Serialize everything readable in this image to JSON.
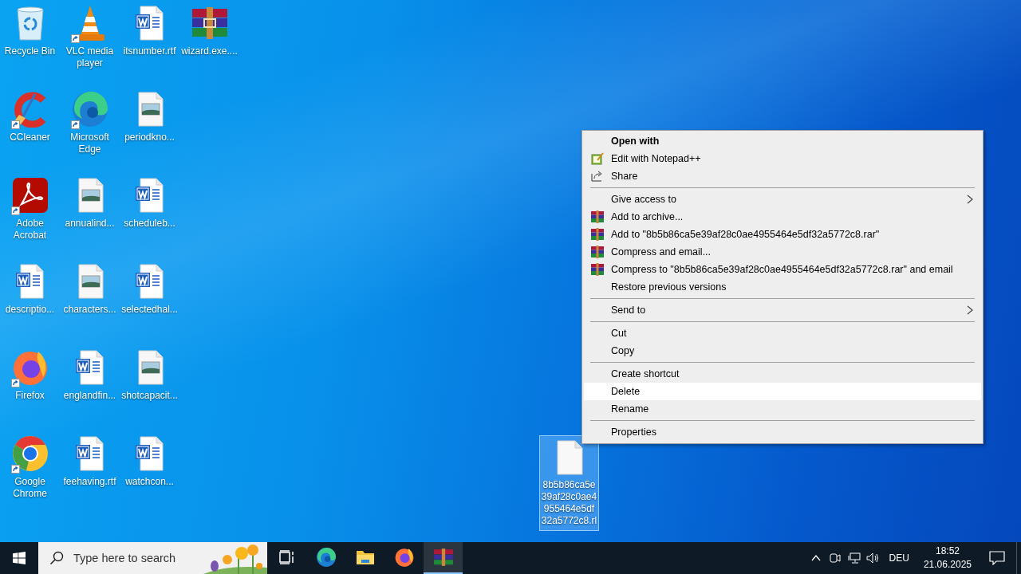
{
  "desktop": {
    "icons": [
      {
        "label": "Recycle Bin",
        "kind": "recycle",
        "shortcut": false,
        "selected": false
      },
      {
        "label": "CCleaner",
        "kind": "ccleaner",
        "shortcut": true,
        "selected": false
      },
      {
        "label": "Adobe Acrobat",
        "kind": "acrobat",
        "shortcut": true,
        "selected": false
      },
      {
        "label": "descriptio...",
        "kind": "word",
        "shortcut": false,
        "selected": false
      },
      {
        "label": "Firefox",
        "kind": "firefox",
        "shortcut": true,
        "selected": false
      },
      {
        "label": "Google Chrome",
        "kind": "chrome",
        "shortcut": true,
        "selected": false
      },
      {
        "label": "VLC media player",
        "kind": "vlc",
        "shortcut": true,
        "selected": false
      },
      {
        "label": "Microsoft Edge",
        "kind": "edge",
        "shortcut": true,
        "selected": false
      },
      {
        "label": "annualind...",
        "kind": "image",
        "shortcut": false,
        "selected": false
      },
      {
        "label": "characters...",
        "kind": "image",
        "shortcut": false,
        "selected": false
      },
      {
        "label": "englandfin...",
        "kind": "word",
        "shortcut": false,
        "selected": false
      },
      {
        "label": "feehaving.rtf",
        "kind": "word",
        "shortcut": false,
        "selected": false
      },
      {
        "label": "itsnumber.rtf",
        "kind": "word",
        "shortcut": false,
        "selected": false
      },
      {
        "label": "periodkno...",
        "kind": "image",
        "shortcut": false,
        "selected": false
      },
      {
        "label": "scheduleb...",
        "kind": "word",
        "shortcut": false,
        "selected": false
      },
      {
        "label": "selectedhal...",
        "kind": "word",
        "shortcut": false,
        "selected": false
      },
      {
        "label": "shotcapacit...",
        "kind": "image",
        "shortcut": false,
        "selected": false
      },
      {
        "label": "watchcon...",
        "kind": "word",
        "shortcut": false,
        "selected": false
      },
      {
        "label": "wizard.exe....",
        "kind": "winrar",
        "shortcut": false,
        "selected": false
      }
    ],
    "loose_file": {
      "label": "8b5b86ca5e39af28c0ae4955464e5df32a5772c8.rl",
      "kind": "file",
      "shortcut": false,
      "selected": true
    }
  },
  "context_menu": {
    "groups": [
      [
        {
          "label": "Open with",
          "kind": "plain",
          "bold": true,
          "submenu": false,
          "highlighted": false
        },
        {
          "label": "Edit with Notepad++",
          "kind": "notepad",
          "bold": false,
          "submenu": false,
          "highlighted": false
        },
        {
          "label": "Share",
          "kind": "share",
          "bold": false,
          "submenu": false,
          "highlighted": false
        }
      ],
      [
        {
          "label": "Give access to",
          "kind": "plain",
          "bold": false,
          "submenu": true,
          "highlighted": false
        },
        {
          "label": "Add to archive...",
          "kind": "winrar",
          "bold": false,
          "submenu": false,
          "highlighted": false
        },
        {
          "label": "Add to \"8b5b86ca5e39af28c0ae4955464e5df32a5772c8.rar\"",
          "kind": "winrar",
          "bold": false,
          "submenu": false,
          "highlighted": false
        },
        {
          "label": "Compress and email...",
          "kind": "winrar",
          "bold": false,
          "submenu": false,
          "highlighted": false
        },
        {
          "label": "Compress to \"8b5b86ca5e39af28c0ae4955464e5df32a5772c8.rar\" and email",
          "kind": "winrar",
          "bold": false,
          "submenu": false,
          "highlighted": false
        },
        {
          "label": "Restore previous versions",
          "kind": "plain",
          "bold": false,
          "submenu": false,
          "highlighted": false
        }
      ],
      [
        {
          "label": "Send to",
          "kind": "plain",
          "bold": false,
          "submenu": true,
          "highlighted": false
        }
      ],
      [
        {
          "label": "Cut",
          "kind": "plain",
          "bold": false,
          "submenu": false,
          "highlighted": false
        },
        {
          "label": "Copy",
          "kind": "plain",
          "bold": false,
          "submenu": false,
          "highlighted": false
        }
      ],
      [
        {
          "label": "Create shortcut",
          "kind": "plain",
          "bold": false,
          "submenu": false,
          "highlighted": false
        },
        {
          "label": "Delete",
          "kind": "plain",
          "bold": false,
          "submenu": false,
          "highlighted": true
        },
        {
          "label": "Rename",
          "kind": "plain",
          "bold": false,
          "submenu": false,
          "highlighted": false
        }
      ],
      [
        {
          "label": "Properties",
          "kind": "plain",
          "bold": false,
          "submenu": false,
          "highlighted": false
        }
      ]
    ]
  },
  "taskbar": {
    "search": {
      "placeholder": "Type here to search"
    },
    "apps": [
      {
        "kind": "taskview",
        "active": false
      },
      {
        "kind": "edge",
        "active": false
      },
      {
        "kind": "explorer",
        "active": false
      },
      {
        "kind": "firefox",
        "active": false
      },
      {
        "kind": "winrar",
        "active": true
      }
    ],
    "tray": {
      "language": "DEU",
      "time": "18:52",
      "date": "21.06.2025"
    }
  }
}
